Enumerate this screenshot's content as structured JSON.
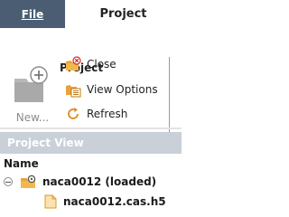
{
  "tabs": {
    "file": "File",
    "project": "Project"
  },
  "ribbon": {
    "group_title": "Project",
    "new_label": "New...",
    "close_label": "Close",
    "view_options_label": "View Options",
    "refresh_label": "Refresh"
  },
  "project_view": {
    "title": "Project View",
    "column_header": "Name",
    "tree": [
      {
        "label": "naca0012 (loaded)",
        "icon": "project-folder-gear-icon",
        "expanded": true
      },
      {
        "label": "naca0012.cas.h5",
        "icon": "case-file-icon"
      }
    ]
  },
  "colors": {
    "file_tab_bg": "#4a5d73",
    "panel_header_bg": "#c9d0d8",
    "folder_orange": "#e8a23a"
  }
}
